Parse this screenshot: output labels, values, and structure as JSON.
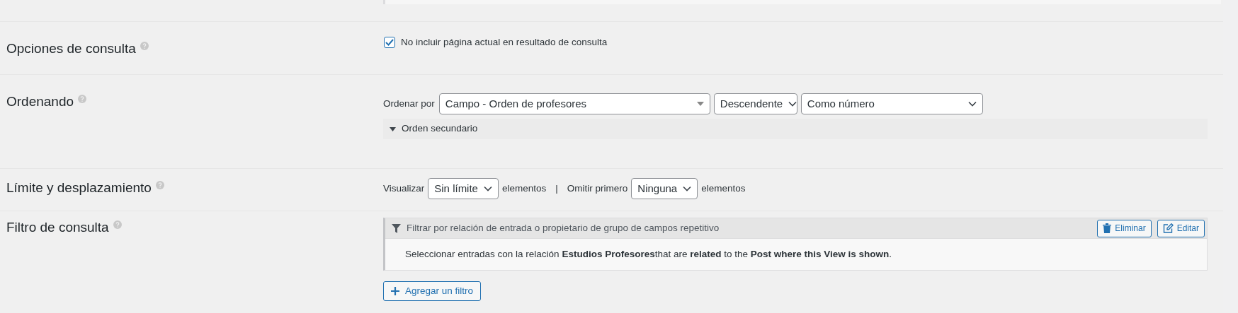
{
  "sections": [
    {
      "kind": "checkbox",
      "label": "Opciones de consulta",
      "checkbox": {
        "label": "No incluir página actual en resultado de consulta",
        "checked": true
      }
    },
    {
      "kind": "ordering",
      "label": "Ordenando",
      "prefix": "Ordenar por",
      "selects": [
        "Campo - Orden de profesores",
        "Descendente",
        "Como número"
      ],
      "secondary": {
        "label": "Orden secundario",
        "expanded": false
      }
    },
    {
      "kind": "limit",
      "label": "Límite y desplazamiento",
      "parts": [
        {
          "text": "Visualizar",
          "select": "Sin límite",
          "suffix": "elementos"
        },
        {
          "text": "Omitir primero",
          "select": "Ninguna",
          "suffix": "elementos"
        }
      ],
      "separator": "|"
    },
    {
      "kind": "filter",
      "label": "Filtro de consulta",
      "filter": {
        "title": "Filtrar por relación de entrada o propietario de grupo de campos repetitivo",
        "buttons": [
          "Eliminar",
          "Editar"
        ],
        "description": "Seleccionar entradas con la relación **Estudios Profesores**that are **related** to the **Post where this View is shown**."
      },
      "add_button": "Agregar un filtro"
    }
  ]
}
